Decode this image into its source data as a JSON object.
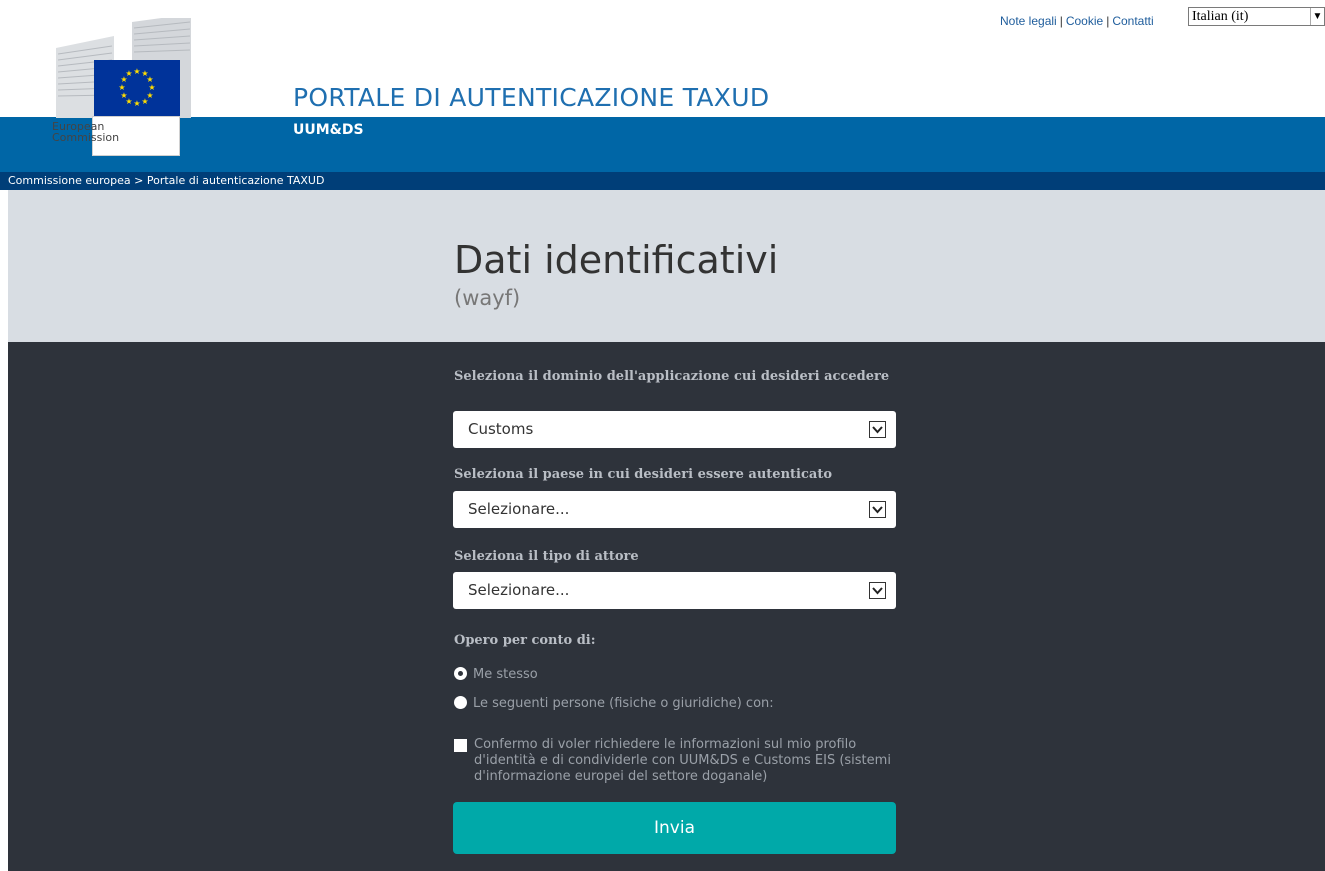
{
  "header": {
    "portal_title": "PORTALE DI AUTENTICAZIONE TAXUD",
    "portal_subtitle": "UUM&DS",
    "logo_line1": "European",
    "logo_line2": "Commission",
    "links": {
      "legal": "Note legali",
      "cookie": "Cookie",
      "contacts": "Contatti",
      "separator": "|"
    },
    "language_select": "Italian (it)"
  },
  "breadcrumb": {
    "home": "Commissione europea",
    "separator": ">",
    "current": "Portale di autenticazione TAXUD"
  },
  "page": {
    "title": "Dati identificativi",
    "subtitle": "(wayf)"
  },
  "form": {
    "domain_label": "Seleziona il dominio dell'applicazione cui desideri accedere",
    "domain_value": "Customs",
    "country_label": "Seleziona il paese in cui desideri essere autenticato",
    "country_value": "Selezionare...",
    "actor_label": "Seleziona il tipo di attore",
    "actor_value": "Selezionare...",
    "behalf_label": "Opero per conto di:",
    "radio_self": "Me stesso",
    "radio_others": "Le seguenti persone (fisiche o giuridiche) con:",
    "consent_text": "Confermo di voler richiedere le informazioni sul mio profilo d'identità e di condividerle con UUM&DS e Customs EIS (sistemi d'informazione europei del settore doganale)",
    "submit_label": "Invia"
  },
  "colors": {
    "brand_blue": "#0066a6",
    "dark_blue": "#003e78",
    "form_bg": "#2e333b",
    "submit": "#00a9a9",
    "flag_blue": "#00339a",
    "flag_star": "#ffdd00"
  }
}
